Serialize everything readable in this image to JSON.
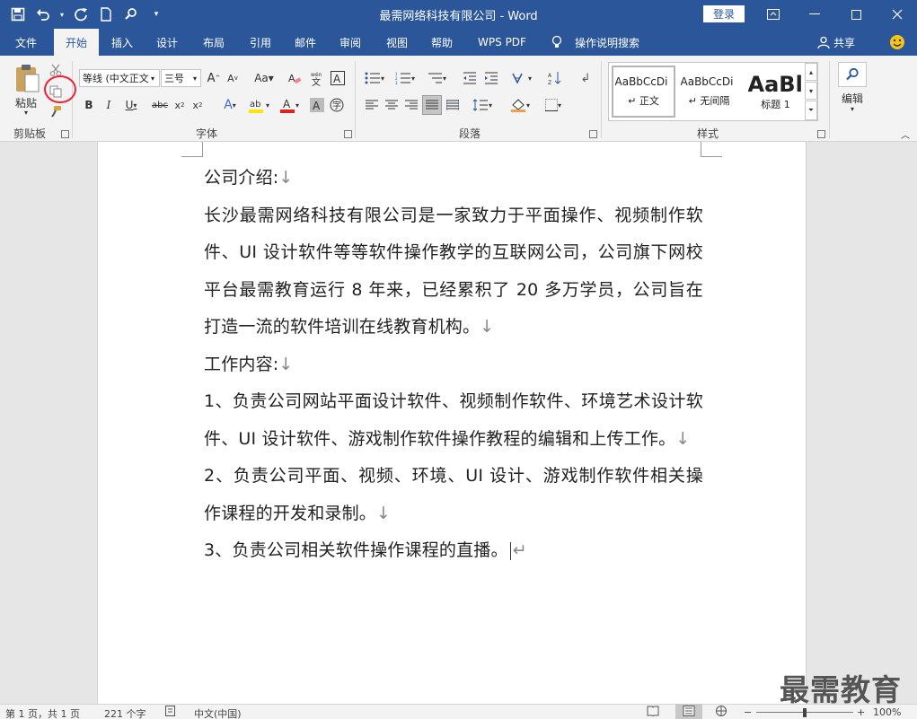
{
  "window": {
    "title": "最需网络科技有限公司 - Word",
    "login_label": "登录"
  },
  "tabs": [
    {
      "label": "文件"
    },
    {
      "label": "开始"
    },
    {
      "label": "插入"
    },
    {
      "label": "设计"
    },
    {
      "label": "布局"
    },
    {
      "label": "引用"
    },
    {
      "label": "邮件"
    },
    {
      "label": "审阅"
    },
    {
      "label": "视图"
    },
    {
      "label": "帮助"
    },
    {
      "label": "WPS PDF"
    },
    {
      "label": "操作说明搜索"
    }
  ],
  "share_label": "共享",
  "ribbon": {
    "clipboard": {
      "paste_label": "粘贴",
      "group_label": "剪贴板"
    },
    "font": {
      "font_name": "等线 (中文正文",
      "font_size": "三号",
      "group_label": "字体"
    },
    "paragraph": {
      "group_label": "段落"
    },
    "styles": {
      "group_label": "样式",
      "items": [
        {
          "preview": "AaBbCcDi",
          "label": "↵ 正文"
        },
        {
          "preview": "AaBbCcDi",
          "label": "↵ 无间隔"
        },
        {
          "preview": "AaBl",
          "label": "标题 1"
        }
      ]
    },
    "editing": {
      "label": "编辑"
    }
  },
  "document": {
    "paragraphs": [
      {
        "text": "公司介绍:",
        "mark": "↓"
      },
      {
        "text": "长沙最需网络科技有限公司是一家致力于平面操作、视频制作软件、UI 设计软件等等软件操作教学的互联网公司，公司旗下网校平台最需教育运行 8 年来，已经累积了 20 多万学员，公司旨在打造一流的软件培训在线教育机构。",
        "mark": "↓"
      },
      {
        "text": "工作内容:",
        "mark": "↓"
      },
      {
        "text": "1、负责公司网站平面设计软件、视频制作软件、环境艺术设计软件、UI 设计软件、游戏制作软件操作教程的编辑和上传工作。",
        "mark": "↓"
      },
      {
        "text": "2、负责公司平面、视频、环境、UI 设计、游戏制作软件相关操作课程的开发和录制。",
        "mark": "↓"
      },
      {
        "text": "3、负责公司相关软件操作课程的直播。",
        "mark": "↵"
      }
    ]
  },
  "status": {
    "page": "第 1 页，共 1 页",
    "words": "221 个字",
    "language": "中文(中国)",
    "zoom": "100%"
  },
  "watermark": "最需教育",
  "colors": {
    "brand": "#2b579a",
    "highlight_circle": "#e22233",
    "font_color_bar": "#d22",
    "highlight_bar": "#ffe600"
  }
}
